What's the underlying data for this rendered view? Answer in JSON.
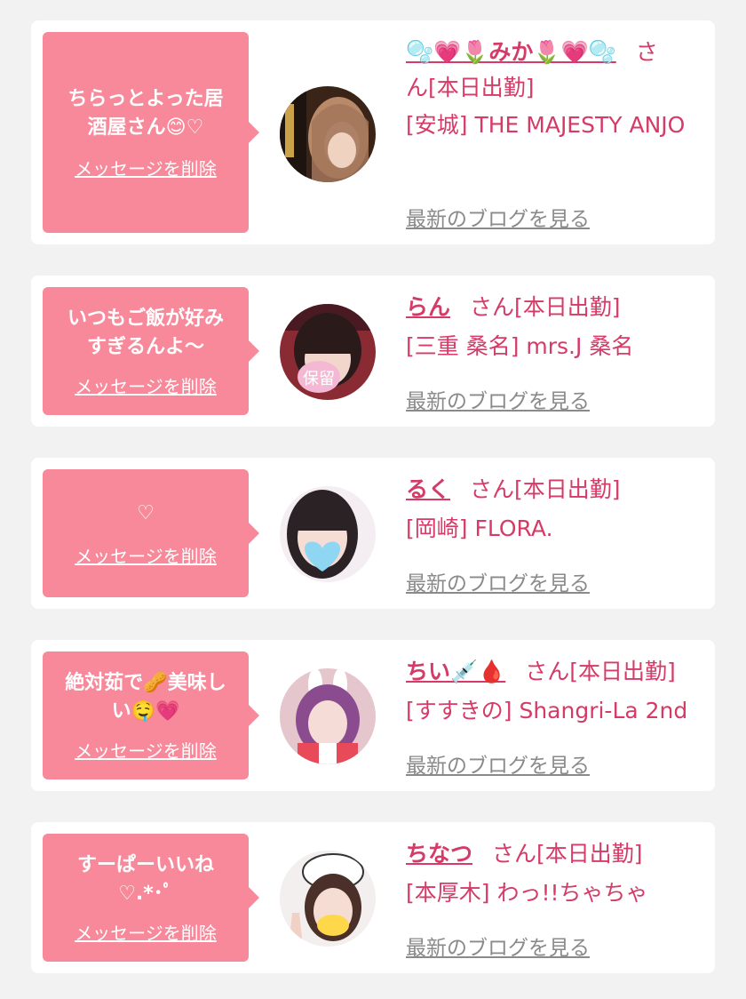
{
  "delete_label": "メッセージを削除",
  "blog_label": "最新のブログを見る",
  "colors": {
    "bubble": "#f7899a",
    "accent": "#d63a66",
    "link_gray": "#8a8a8a",
    "background": "#f2f2f3"
  },
  "cards": [
    {
      "message": "ちらっとよった居\n酒屋さん😊♡",
      "avatar_icon": "profile-photo-icon",
      "name": "🫧💗🌷みか🌷💗🫧",
      "san": "さ",
      "line1_rest": "ん[本日出勤]",
      "store": "[安城] THE MAJESTY ANJO"
    },
    {
      "message": "いつもご飯が好み\nすぎるんよ〜",
      "avatar_icon": "profile-photo-icon",
      "avatar_badge": "保留",
      "name": "らん",
      "san": "さん[本日出勤]",
      "store": "[三重 桑名] mrs.J 桑名"
    },
    {
      "message": "♡",
      "avatar_icon": "profile-photo-icon",
      "name": "るく",
      "san": "さん[本日出勤]",
      "store": "[岡崎] FLORA."
    },
    {
      "message": "絶対茹で🥜美味し\nい🤤💗",
      "avatar_icon": "profile-photo-icon",
      "name": "ちい💉🩸",
      "san": "さん[本日出勤]",
      "store": "[すすきの] Shangri-La 2nd"
    },
    {
      "message": "すーぱーいいね\n♡.*･ﾟ",
      "avatar_icon": "profile-photo-icon",
      "name": "ちなつ",
      "san": "さん[本日出勤]",
      "store": "[本厚木] わっ!!ちゃちゃ"
    }
  ]
}
